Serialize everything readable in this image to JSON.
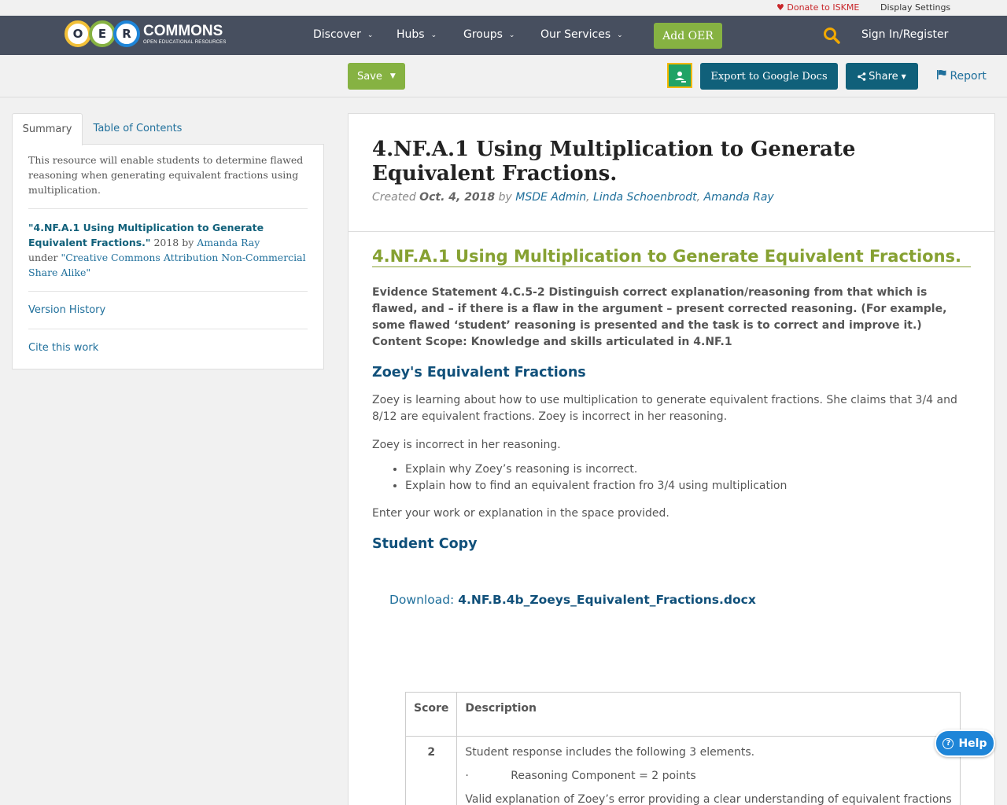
{
  "utility": {
    "donate": "Donate to ISKME",
    "display_settings": "Display Settings"
  },
  "nav": {
    "logo_text": "COMMONS",
    "logo_sub": "OPEN EDUCATIONAL RESOURCES",
    "logo_letters": [
      "O",
      "E",
      "R"
    ],
    "items": [
      {
        "label": "Discover"
      },
      {
        "label": "Hubs"
      },
      {
        "label": "Groups"
      },
      {
        "label": "Our Services"
      }
    ],
    "add_oer": "Add OER",
    "signin": "Sign In/Register"
  },
  "toolbar": {
    "save": "Save",
    "export": "Export to Google Docs",
    "share": "Share",
    "report": "Report"
  },
  "sidebar": {
    "tabs": [
      "Summary",
      "Table of Contents"
    ],
    "summary": "This resource will enable students to determine flawed reasoning when generating equivalent fractions using multiplication.",
    "cite_title": "\"4.NF.A.1 Using Multiplication to Generate Equivalent Fractions.\"",
    "cite_year": "2018 by",
    "cite_author": "Amanda Ray",
    "cite_under": "under",
    "cite_license": "\"Creative Commons Attribution Non-Commercial Share Alike\"",
    "version_history": "Version History",
    "cite_work": "Cite this work"
  },
  "resource": {
    "title": "4.NF.A.1 Using Multiplication to Generate Equivalent Fractions.",
    "created_label": "Created",
    "created_date": "Oct. 4, 2018",
    "by": "by",
    "authors": [
      "MSDE Admin",
      "Linda Schoenbrodt",
      "Amanda Ray"
    ],
    "section_title": "4.NF.A.1 Using Multiplication to Generate Equivalent Fractions.",
    "evidence": "Evidence Statement 4.C.5-2 Distinguish correct explanation/reasoning from that which is flawed, and – if there is a flaw in the argument – present corrected reasoning. (For example, some flawed ‘student’ reasoning is presented and the task is to correct and improve it.) Content Scope: Knowledge and skills articulated in 4.NF.1",
    "subhead1": "Zoey's Equivalent Fractions",
    "para1": "Zoey is learning about how to use multiplication to generate equivalent fractions. She claims that 3/4 and 8/12 are equivalent fractions. Zoey is incorrect in her reasoning.",
    "para2": "Zoey is incorrect in her reasoning.",
    "bullets": [
      "Explain why Zoey’s reasoning is incorrect.",
      "Explain how to find an equivalent fraction fro 3/4 using multiplication"
    ],
    "para3": "Enter your work or explanation in the space provided.",
    "subhead2": "Student Copy",
    "download_label": "Download:",
    "download_file": "4.NF.B.4b_Zoeys_Equivalent_Fractions.docx",
    "rubric": {
      "headers": [
        "Score",
        "Description"
      ],
      "rows": [
        {
          "score": "2",
          "line1": "Student response includes the following 3 elements.",
          "line2": "·            Reasoning Component = 2 points",
          "line3": "Valid explanation of Zoey’s error providing a clear understanding of equivalent fractions"
        }
      ]
    }
  },
  "help": "Help",
  "colors": {
    "nav_bg": "#474f5f",
    "green": "#86b242",
    "teal": "#10607a",
    "link": "#20709c"
  }
}
